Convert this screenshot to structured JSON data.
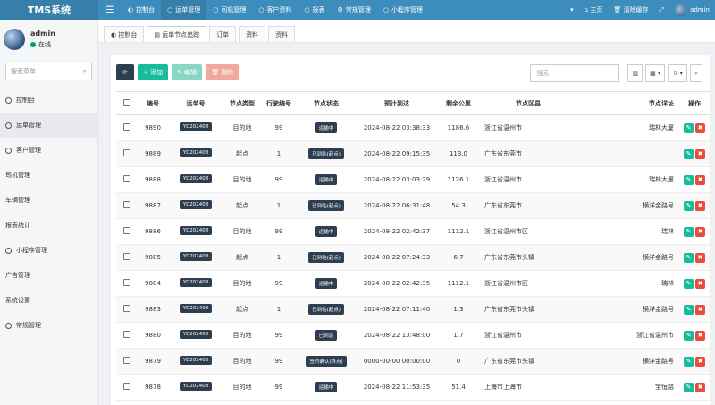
{
  "app": {
    "title": "TMS系统"
  },
  "topnav": {
    "toggle_icon": "menu-icon",
    "items": [
      {
        "label": "控制台",
        "icon": "dashboard-icon"
      },
      {
        "label": "运单管理",
        "icon": "circle-icon",
        "active": true
      },
      {
        "label": "司机管理",
        "icon": "circle-icon"
      },
      {
        "label": "客户资料",
        "icon": "circle-icon"
      },
      {
        "label": "报表",
        "icon": "circle-icon"
      },
      {
        "label": "常规管理",
        "icon": "cogs-icon"
      },
      {
        "label": "小程序管理",
        "icon": "circle-icon"
      }
    ],
    "right": {
      "lang": "▾",
      "home": "主页",
      "clear": "清除缓存",
      "fullscreen": "⤢",
      "user": "admin"
    }
  },
  "sidebar": {
    "username": "admin",
    "status": "在线",
    "search_placeholder": "搜索菜单",
    "items": [
      {
        "label": "控制台"
      },
      {
        "label": "运单管理",
        "active": true
      },
      {
        "label": "客户管理"
      },
      {
        "label": "司机管理"
      },
      {
        "label": "车辆管理"
      },
      {
        "label": "报表统计"
      },
      {
        "label": "小程序管理"
      },
      {
        "label": "广告管理"
      },
      {
        "label": "系统设置"
      },
      {
        "label": "常规管理"
      }
    ]
  },
  "tabs": [
    {
      "label": "控制台",
      "icon": "dashboard-icon"
    },
    {
      "label": "运单节点追踪",
      "active": true
    },
    {
      "label": "订单"
    },
    {
      "label": "资料"
    },
    {
      "label": "资料"
    }
  ],
  "toolbar": {
    "refresh_icon": "refresh-icon",
    "add": "+ 添加",
    "edit": "✎ 编辑",
    "delete": "🗑 删除",
    "search_placeholder": "搜索",
    "columns_icon": "columns-icon",
    "export_icon": "export-icon"
  },
  "table": {
    "columns": [
      "",
      "编号",
      "运单号",
      "节点类型",
      "行驶编号",
      "节点状态",
      "预计到达",
      "剩余公里",
      "节点区县",
      "节点详址",
      "操作"
    ],
    "rows": [
      {
        "id": "9890",
        "waybill": "YD202408",
        "type": "目的地",
        "seq": "99",
        "status": "运输中",
        "eta": "2024-08-22 03:38:33",
        "km": "1186.6",
        "area": "浙江省温州市",
        "addr": "瑞林大厦"
      },
      {
        "id": "9889",
        "waybill": "YD202408",
        "type": "起点",
        "seq": "1",
        "status": "已到站(起点)",
        "eta": "2024-08-22 09:15:35",
        "km": "113.0",
        "area": "广东省东莞市",
        "addr": ""
      },
      {
        "id": "9888",
        "waybill": "YD202408",
        "type": "目的地",
        "seq": "99",
        "status": "运输中",
        "eta": "2024-08-22 03:03:29",
        "km": "1126.1",
        "area": "浙江省温州市",
        "addr": "瑞林大厦"
      },
      {
        "id": "9887",
        "waybill": "YD202408",
        "type": "起点",
        "seq": "1",
        "status": "已到站(起点)",
        "eta": "2024-08-22 06:31:48",
        "km": "54.3",
        "area": "广东省东莞市",
        "addr": "横洋金路号"
      },
      {
        "id": "9886",
        "waybill": "YD202408",
        "type": "目的地",
        "seq": "99",
        "status": "运输中",
        "eta": "2024-08-22 02:42:37",
        "km": "1112.1",
        "area": "浙江省温州市区",
        "addr": "瑞林"
      },
      {
        "id": "9885",
        "waybill": "YD202408",
        "type": "起点",
        "seq": "1",
        "status": "已到站(起点)",
        "eta": "2024-08-22 07:24:33",
        "km": "6.7",
        "area": "广东省东莞市头镇",
        "addr": "横洋金路号"
      },
      {
        "id": "9884",
        "waybill": "YD202408",
        "type": "目的地",
        "seq": "99",
        "status": "运输中",
        "eta": "2024-08-22 02:42:35",
        "km": "1112.1",
        "area": "浙江省温州市区",
        "addr": "瑞林"
      },
      {
        "id": "9883",
        "waybill": "YD202408",
        "type": "起点",
        "seq": "1",
        "status": "已到站(起点)",
        "eta": "2024-08-22 07:11:40",
        "km": "1.3",
        "area": "广东省东莞市头镇",
        "addr": "横洋金路号"
      },
      {
        "id": "9880",
        "waybill": "YD202408",
        "type": "目的地",
        "seq": "99",
        "status": "已到达",
        "eta": "2024-08-22 13:48:00",
        "km": "1.7",
        "area": "浙江省温州市",
        "addr": "浙江省温州市"
      },
      {
        "id": "9879",
        "waybill": "YD202408",
        "type": "目的地",
        "seq": "99",
        "status": "签约确认(终点)",
        "eta": "0000-00-00 00:00:00",
        "km": "0",
        "area": "广东省东莞市头镇",
        "addr": "横洋金路号"
      },
      {
        "id": "9878",
        "waybill": "YD202408",
        "type": "目的地",
        "seq": "99",
        "status": "运输中",
        "eta": "2024-08-22 11:53:35",
        "km": "51.4",
        "area": "上海市上海市",
        "addr": "宝恒路"
      }
    ]
  }
}
